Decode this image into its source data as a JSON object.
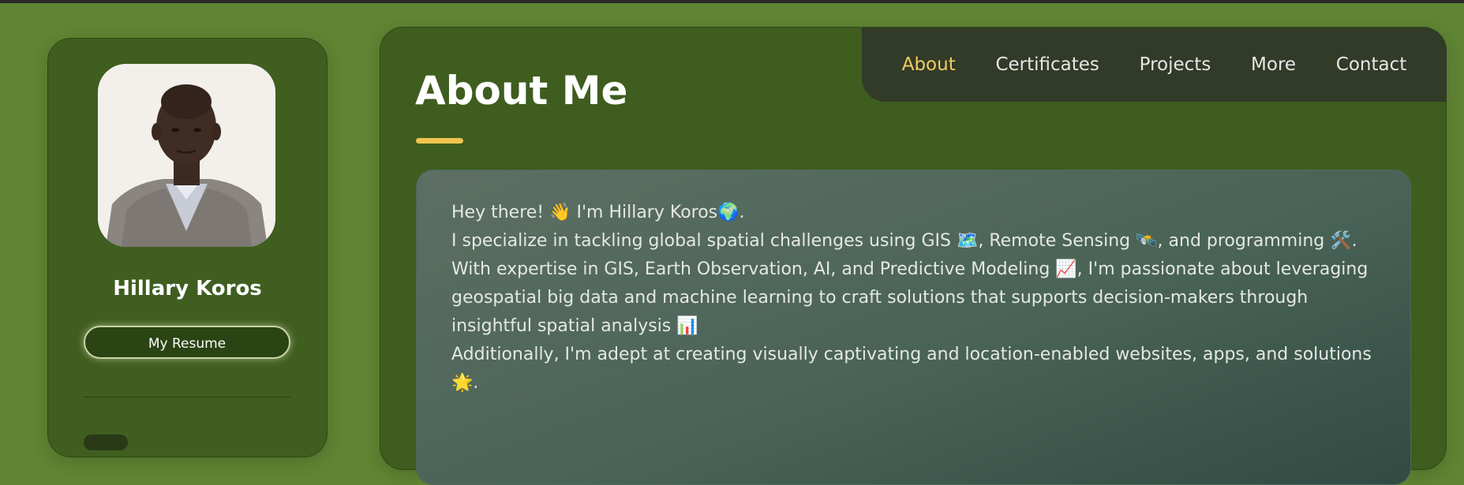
{
  "sidebar": {
    "name": "Hillary Koros",
    "resume_label": "My Resume"
  },
  "nav": {
    "items": [
      {
        "label": "About",
        "active": true
      },
      {
        "label": "Certificates"
      },
      {
        "label": "Projects"
      },
      {
        "label": "More"
      },
      {
        "label": "Contact"
      }
    ]
  },
  "main": {
    "title": "About Me",
    "paragraphs": [
      "Hey there! 👋 I'm Hillary Koros🌍.",
      "I specialize in tackling global spatial challenges using GIS 🗺️, Remote Sensing 🛰️, and programming 🛠️.",
      "With expertise in GIS, Earth Observation, AI, and Predictive Modeling 📈, I'm passionate about leveraging geospatial big data and machine learning to craft solutions that supports decision-makers through insightful spatial analysis 📊",
      "Additionally, I'm adept at creating visually captivating and location-enabled websites, apps, and solutions 🌟."
    ]
  },
  "colors": {
    "background": "#5f8433",
    "card": "#3e5d1e",
    "navbar": "#323a28",
    "accent": "#f0cd63"
  }
}
